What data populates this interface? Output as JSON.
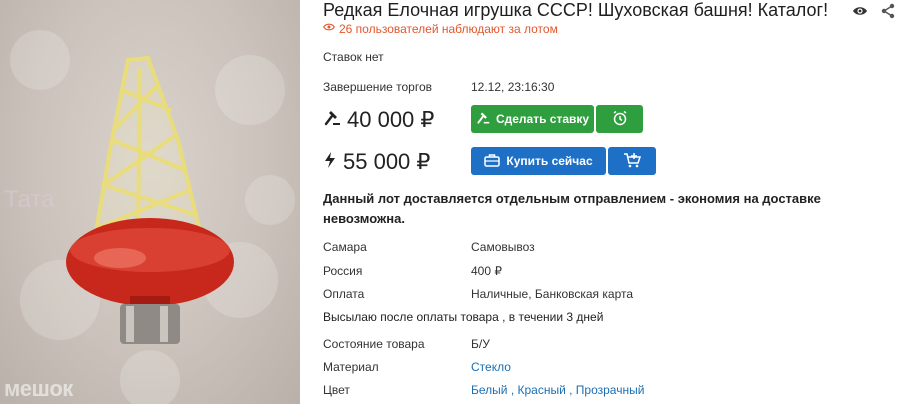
{
  "lot": {
    "title": "Редкая Елочная игрушка СССР! Шуховская башня! Каталог!",
    "watchers": "26 пользователей наблюдают за лотом"
  },
  "icons": {
    "top": [
      "eye-icon",
      "share-icon"
    ],
    "watchers": "eye-icon",
    "bid": "gavel-icon",
    "buy": "lightning-icon",
    "alarm": "alarm-clock-icon",
    "cart": "add-to-cart-icon",
    "briefcase": "briefcase-icon"
  },
  "photo": {
    "watermark": "мешок",
    "left_watermark": "Тата"
  },
  "auction": {
    "bids": "Ставок нет",
    "end_label": "Завершение торгов",
    "end_value": "12.12, 23:16:30",
    "current_price": "40 000 ₽",
    "bid_button": "Сделать ставку",
    "buy_now_price": "55 000 ₽",
    "buy_button": "Купить сейчас"
  },
  "notice": {
    "bold": "Данный лот доставляется отдельным отправлением",
    "rest": " - экономия на доставке невозможна."
  },
  "details": [
    {
      "label": "Самара",
      "value": "Самовывоз"
    },
    {
      "label": "Россия",
      "value": "400 ₽"
    },
    {
      "label": "Оплата",
      "value": "Наличные, Банковская карта"
    }
  ],
  "shipping_note": "Высылаю после оплаты товара , в течении 3 дней",
  "attributes": [
    {
      "label": "Состояние товара",
      "value": "Б/У"
    },
    {
      "label": "Материал",
      "value": "Стекло"
    },
    {
      "label": "Цвет",
      "value": "Белый , Красный , Прозрачный"
    }
  ],
  "colors": {
    "green": "#2f9e3f",
    "blue": "#1e6fc6",
    "accent_orange": "#e2572c",
    "link": "#1a6fb5"
  }
}
